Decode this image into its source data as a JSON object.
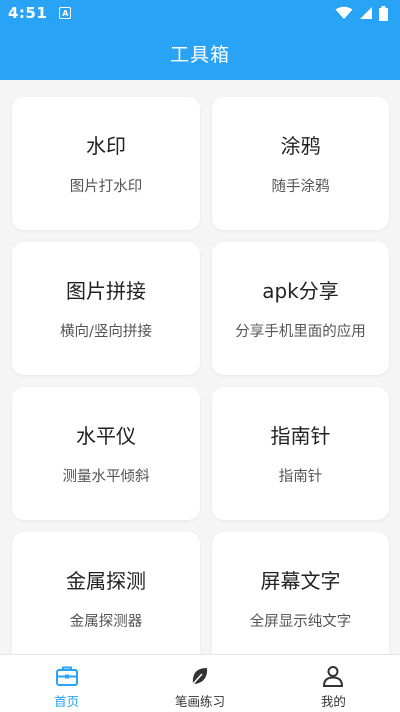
{
  "status_bar": {
    "time": "4:51",
    "notification_letter": "A"
  },
  "app_bar": {
    "title": "工具箱"
  },
  "tools": [
    {
      "title": "水印",
      "subtitle": "图片打水印"
    },
    {
      "title": "涂鸦",
      "subtitle": "随手涂鸦"
    },
    {
      "title": "图片拼接",
      "subtitle": "横向/竖向拼接"
    },
    {
      "title": "apk分享",
      "subtitle": "分享手机里面的应用"
    },
    {
      "title": "水平仪",
      "subtitle": "测量水平倾斜"
    },
    {
      "title": "指南针",
      "subtitle": "指南针"
    },
    {
      "title": "金属探测",
      "subtitle": "金属探测器"
    },
    {
      "title": "屏幕文字",
      "subtitle": "全屏显示纯文字"
    }
  ],
  "bottom_nav": {
    "items": [
      {
        "label": "首页",
        "icon": "toolbox-icon",
        "active": true
      },
      {
        "label": "笔画练习",
        "icon": "leaf-icon",
        "active": false
      },
      {
        "label": "我的",
        "icon": "person-icon",
        "active": false
      }
    ]
  },
  "colors": {
    "primary": "#29a3f5",
    "background": "#f5f5f5",
    "card": "#ffffff"
  }
}
